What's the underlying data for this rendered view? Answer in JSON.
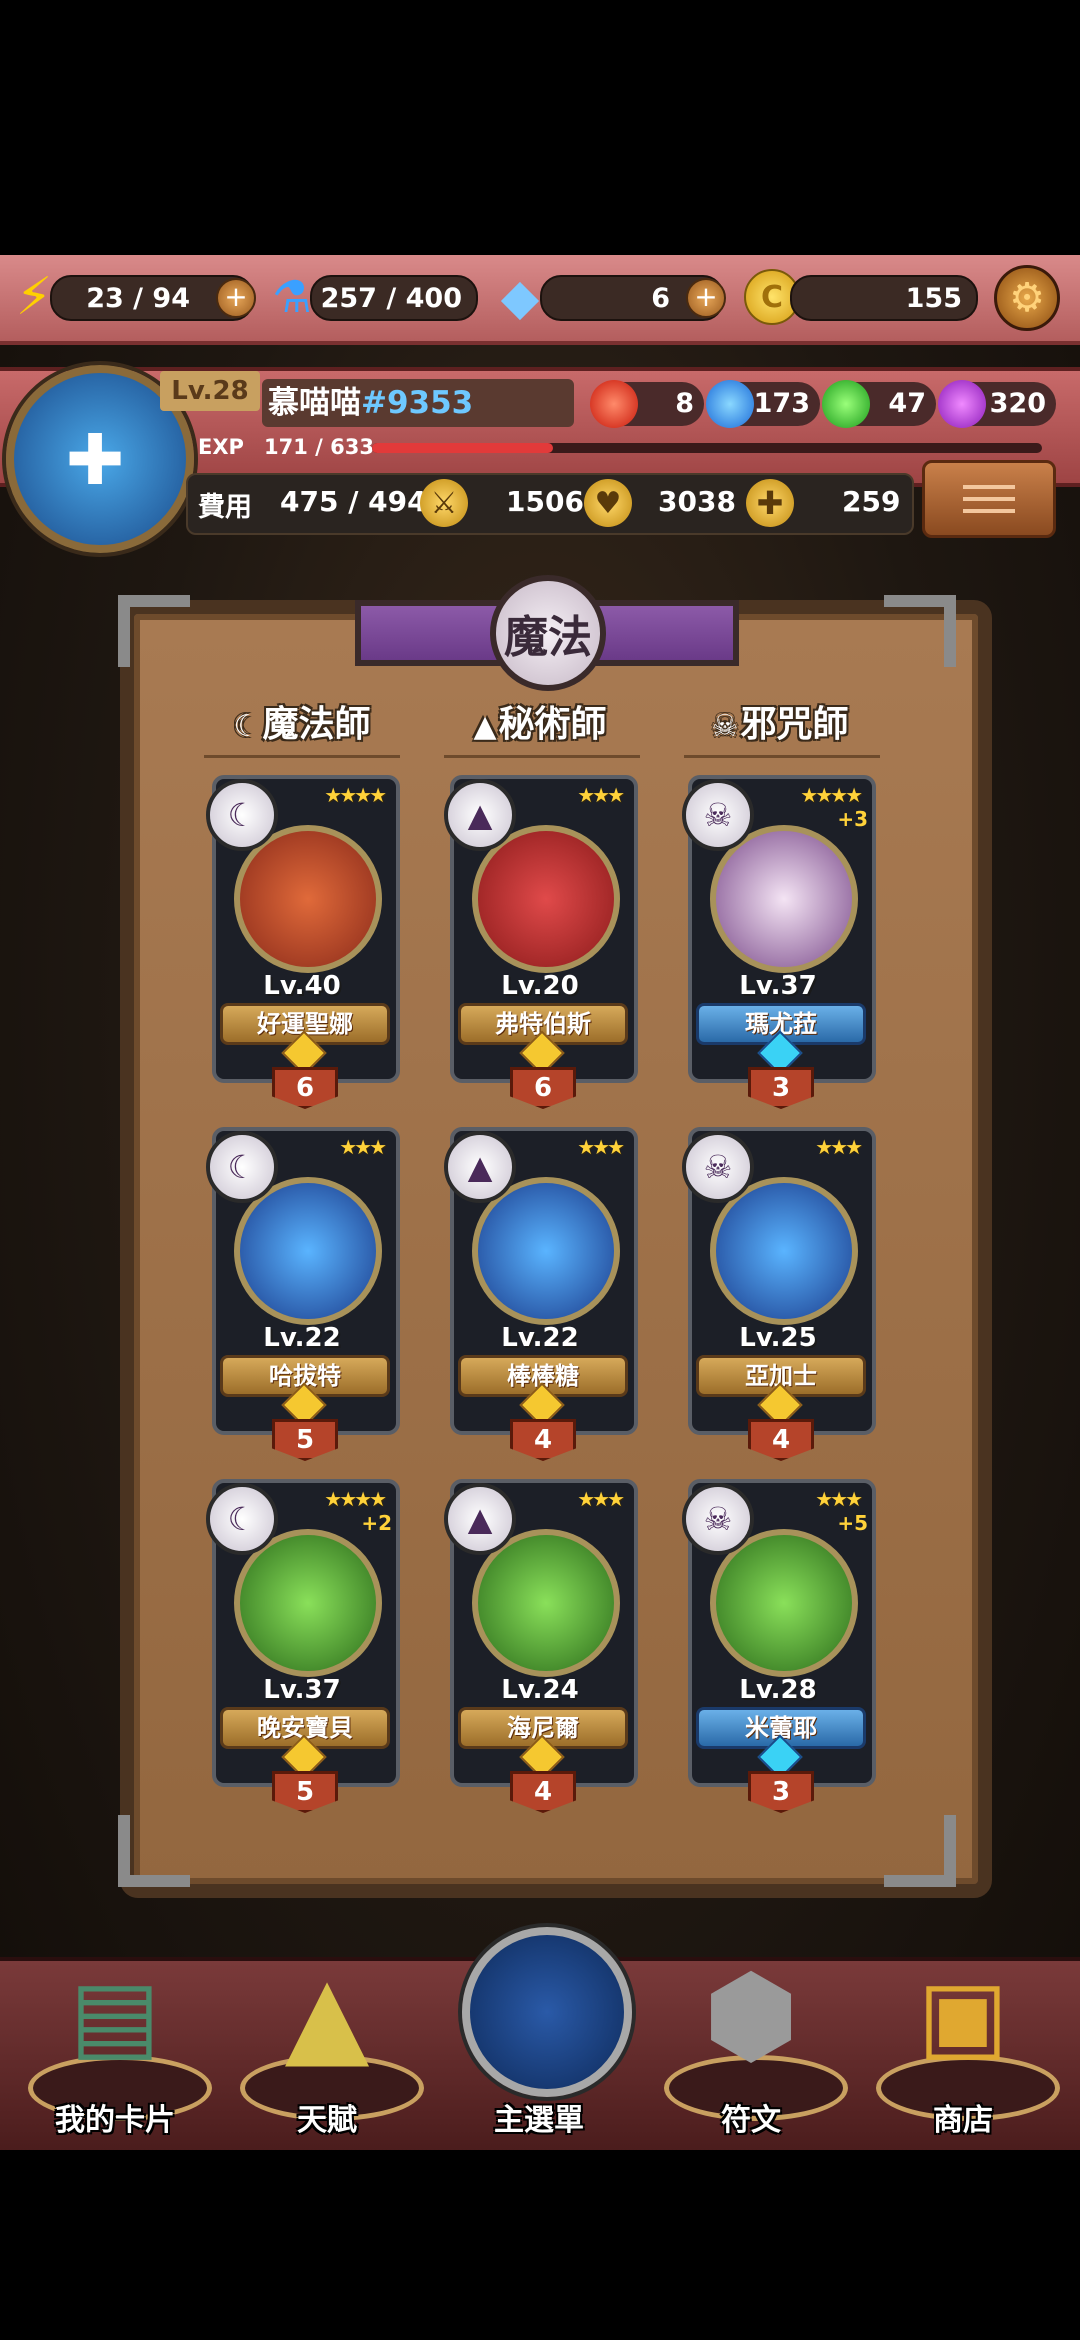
{
  "resources": {
    "energy": "23 / 94",
    "potion": "257 / 400",
    "diamond": "6",
    "gold": "155"
  },
  "profile": {
    "level": "Lv.28",
    "name": "慕喵喵",
    "tag": "#9353",
    "exp_label": "EXP",
    "exp_value": "171 / 633",
    "exp_fraction": 0.27,
    "elements": {
      "fire": "8",
      "water": "173",
      "nature": "47",
      "dark": "320"
    },
    "cost_label": "費用",
    "cost_value": "475 / 494",
    "attack": "1506",
    "hp": "3038",
    "heal": "259"
  },
  "panel": {
    "title": "魔法",
    "columns": [
      {
        "name": "魔法師",
        "icon": "wizard-icon"
      },
      {
        "name": "秘術師",
        "icon": "witch-hat-icon"
      },
      {
        "name": "邪咒師",
        "icon": "skull-icon"
      }
    ]
  },
  "cards": [
    {
      "stars": "★★★★",
      "bonus": "",
      "level": "Lv.40",
      "name": "好運聖娜",
      "cost": "6",
      "badge": "gold"
    },
    {
      "stars": "★★★",
      "bonus": "",
      "level": "Lv.20",
      "name": "弗特伯斯",
      "cost": "6",
      "badge": "gold"
    },
    {
      "stars": "★★★★",
      "bonus": "+3",
      "level": "Lv.37",
      "name": "瑪尤菈",
      "cost": "3",
      "badge": "blue"
    },
    {
      "stars": "★★★",
      "bonus": "",
      "level": "Lv.22",
      "name": "哈拔特",
      "cost": "5",
      "badge": "gold"
    },
    {
      "stars": "★★★",
      "bonus": "",
      "level": "Lv.22",
      "name": "棒棒糖",
      "cost": "4",
      "badge": "gold"
    },
    {
      "stars": "★★★",
      "bonus": "",
      "level": "Lv.25",
      "name": "亞加士",
      "cost": "4",
      "badge": "gold"
    },
    {
      "stars": "★★★★",
      "bonus": "+2",
      "level": "Lv.37",
      "name": "晚安寶貝",
      "cost": "5",
      "badge": "gold"
    },
    {
      "stars": "★★★",
      "bonus": "",
      "level": "Lv.24",
      "name": "海尼爾",
      "cost": "4",
      "badge": "gold"
    },
    {
      "stars": "★★★",
      "bonus": "+5",
      "level": "Lv.28",
      "name": "米蕾耶",
      "cost": "3",
      "badge": "blue"
    }
  ],
  "nav": [
    "我的卡片",
    "天賦",
    "主選單",
    "符文",
    "商店"
  ]
}
